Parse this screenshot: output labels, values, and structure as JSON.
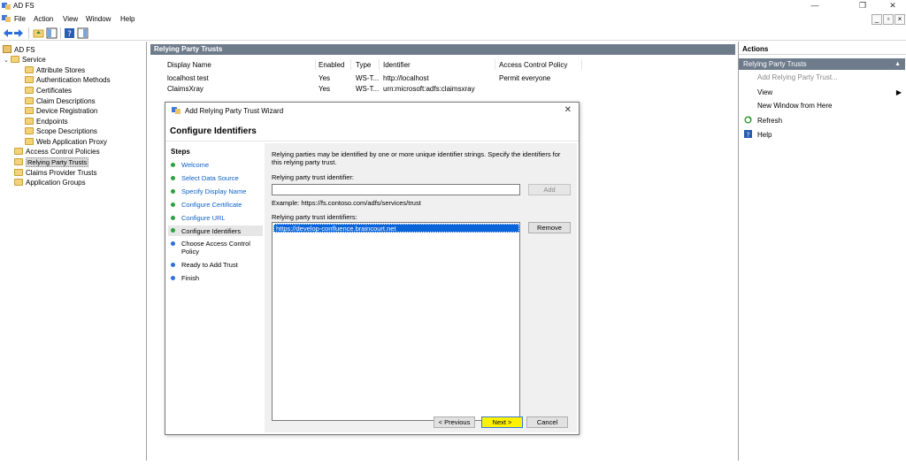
{
  "window": {
    "title": "AD FS",
    "controls": {
      "minimize": "—",
      "restore": "❐",
      "close": "✕"
    }
  },
  "menu": {
    "items": [
      "File",
      "Action",
      "View",
      "Window",
      "Help"
    ],
    "mdi_controls": {
      "minimize": "_",
      "restore": "▫",
      "close": "×"
    }
  },
  "tree": {
    "items": [
      {
        "label": "AD FS",
        "level": 0
      },
      {
        "label": "Service",
        "level": 1
      },
      {
        "label": "Attribute Stores",
        "level": 2
      },
      {
        "label": "Authentication Methods",
        "level": 2
      },
      {
        "label": "Certificates",
        "level": 2
      },
      {
        "label": "Claim Descriptions",
        "level": 2
      },
      {
        "label": "Device Registration",
        "level": 2
      },
      {
        "label": "Endpoints",
        "level": 2
      },
      {
        "label": "Scope Descriptions",
        "level": 2
      },
      {
        "label": "Web Application Proxy",
        "level": 2
      },
      {
        "label": "Access Control Policies",
        "level": 1
      },
      {
        "label": "Relying Party Trusts",
        "level": 1
      },
      {
        "label": "Claims Provider Trusts",
        "level": 1
      },
      {
        "label": "Application Groups",
        "level": 1
      }
    ]
  },
  "center": {
    "header": "Relying Party Trusts",
    "columns": [
      "Display Name",
      "Enabled",
      "Type",
      "Identifier",
      "Access Control Policy"
    ],
    "rows": [
      [
        "localhost test",
        "Yes",
        "WS-T...",
        "http://localhost",
        "Permit everyone"
      ],
      [
        "ClaimsXray",
        "Yes",
        "WS-T...",
        "urn:microsoft:adfs:claimsxray",
        ""
      ]
    ]
  },
  "actions": {
    "title": "Actions",
    "section": "Relying Party Trusts",
    "items": [
      {
        "label": "Add Relying Party Trust...",
        "enabled": false
      },
      {
        "label": "View",
        "enabled": true
      },
      {
        "label": "New Window from Here",
        "enabled": true
      },
      {
        "label": "Refresh",
        "enabled": true
      },
      {
        "label": "Help",
        "enabled": true
      }
    ]
  },
  "dialog": {
    "title": "Add Relying Party Trust Wizard",
    "heading": "Configure Identifiers",
    "close": "✕",
    "steps_title": "Steps",
    "steps": [
      {
        "label": "Welcome",
        "state": "done"
      },
      {
        "label": "Select Data Source",
        "state": "done"
      },
      {
        "label": "Specify Display Name",
        "state": "done"
      },
      {
        "label": "Configure Certificate",
        "state": "done"
      },
      {
        "label": "Configure URL",
        "state": "done"
      },
      {
        "label": "Configure Identifiers",
        "state": "current"
      },
      {
        "label": "Choose Access Control Policy",
        "state": "pending"
      },
      {
        "label": "Ready to Add Trust",
        "state": "pending"
      },
      {
        "label": "Finish",
        "state": "pending"
      }
    ],
    "description": "Relying parties may be identified by one or more unique identifier strings. Specify the identifiers for this relying party trust.",
    "identifier_label": "Relying party trust identifier:",
    "identifier_value": "",
    "add_label": "Add",
    "example": "Example: https://fs.contoso.com/adfs/services/trust",
    "identifiers_label": "Relying party trust identifiers:",
    "identifiers": [
      "https://develop-confluence.braincourt.net"
    ],
    "remove_label": "Remove",
    "previous_label": "< Previous",
    "next_label": "Next >",
    "cancel_label": "Cancel"
  },
  "colors": {
    "header_bg": "#6e7b8b",
    "step_done": "#2ea043",
    "step_pending": "#2f6fd6",
    "selection": "#0a64d9",
    "next_button": "#fff200"
  }
}
